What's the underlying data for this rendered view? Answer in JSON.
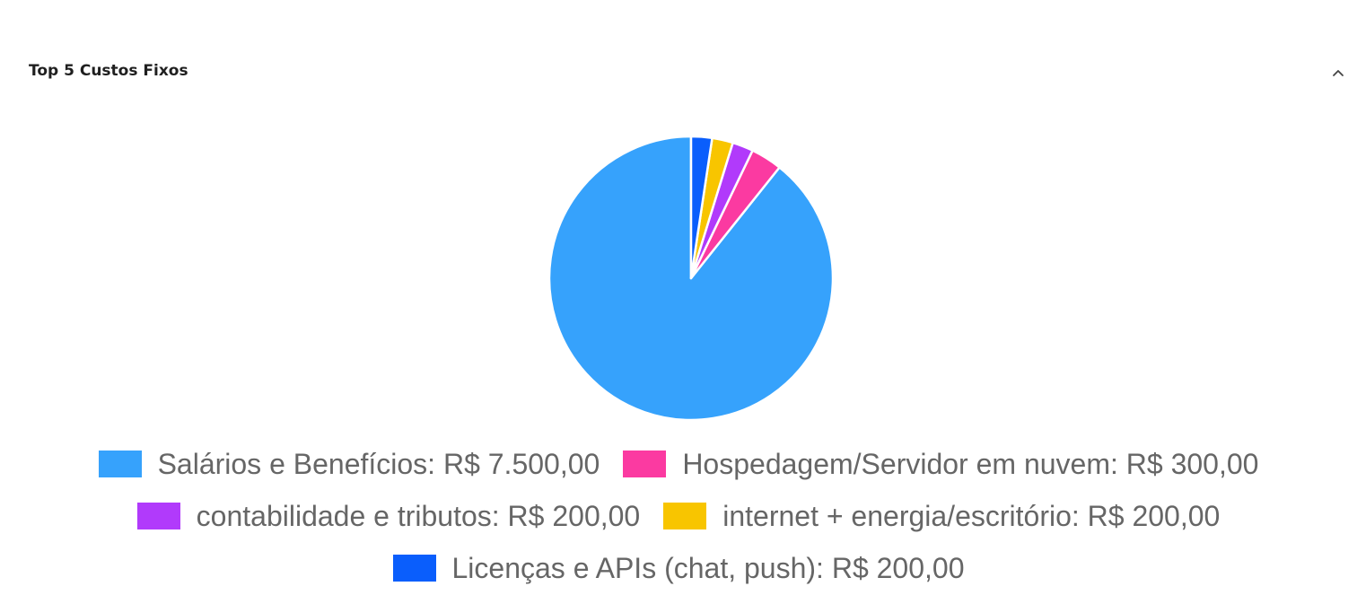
{
  "panel": {
    "title": "Top 5 Custos Fixos",
    "toggle_icon": "chevron-up-icon"
  },
  "chart_data": {
    "type": "pie",
    "title": "Top 5 Custos Fixos",
    "legend_position": "bottom",
    "slices": [
      {
        "label": "Salários e Benefícios",
        "value": 7500,
        "color": "#36a2fc"
      },
      {
        "label": "Hospedagem/Servidor em nuvem",
        "value": 300,
        "color": "#fb3aa1"
      },
      {
        "label": "contabilidade e tributos",
        "value": 200,
        "color": "#b13afb"
      },
      {
        "label": "internet + energia/escritório",
        "value": 200,
        "color": "#f8c500"
      },
      {
        "label": "Licenças e APIs (chat, push)",
        "value": 200,
        "color": "#0a5efc"
      }
    ]
  },
  "legend": {
    "rows": [
      [
        {
          "text": "Salários e Benefícios: R$ 7.500,00",
          "color": "#36a2fc"
        },
        {
          "text": "Hospedagem/Servidor em nuvem: R$ 300,00",
          "color": "#fb3aa1"
        }
      ],
      [
        {
          "text": "contabilidade e tributos: R$ 200,00",
          "color": "#b13afb"
        },
        {
          "text": "internet + energia/escritório: R$ 200,00",
          "color": "#f8c500"
        }
      ],
      [
        {
          "text": "Licenças e APIs (chat, push): R$ 200,00",
          "color": "#0a5efc"
        }
      ]
    ]
  }
}
